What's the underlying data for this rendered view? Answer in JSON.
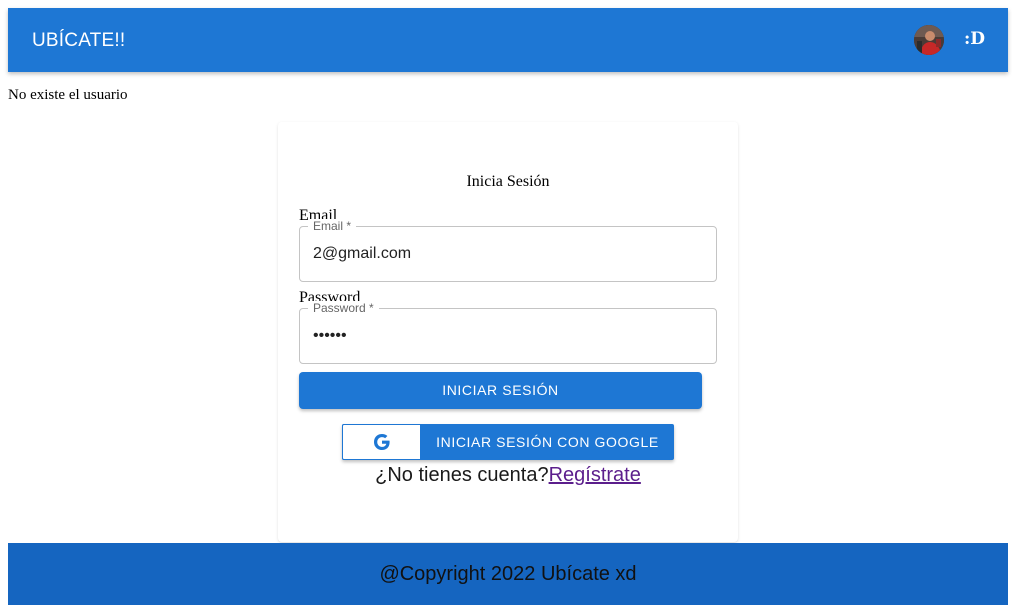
{
  "header": {
    "brand": "UBÍCATE!!",
    "user_label": ":D",
    "avatar_icon": "user-avatar-photo",
    "bg_color": "#1e77d4"
  },
  "message": "No existe el usuario",
  "login": {
    "title": "Inicia Sesión",
    "email": {
      "label": "Email",
      "legend": "Email *",
      "value": "2@gmail.com"
    },
    "password": {
      "label": "Password",
      "legend": "Password *",
      "value": "••••••"
    },
    "submit_label": "INICIAR SESIÓN",
    "google": {
      "label": "INICIAR SESIÓN CON GOOGLE",
      "icon": "google-g-icon"
    },
    "register": {
      "prompt": "¿No tienes cuenta?",
      "link": "Regístrate"
    }
  },
  "footer": {
    "text": "@Copyright 2022 Ubícate xd",
    "bg_color": "#1565c0"
  }
}
